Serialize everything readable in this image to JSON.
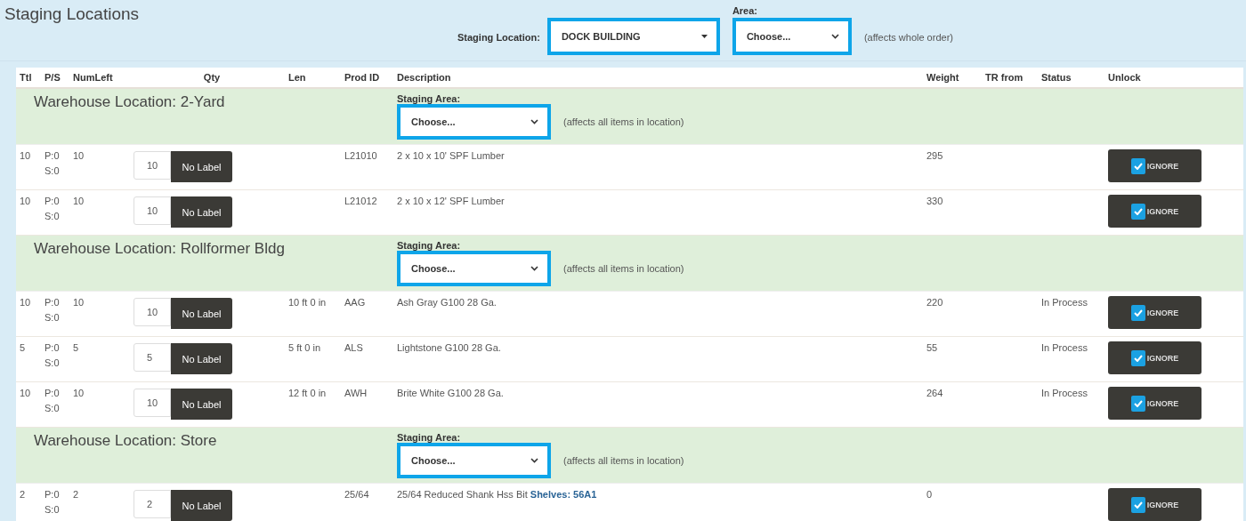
{
  "title": "Staging Locations",
  "order_controls": {
    "staging_location": {
      "label": "Staging Location:",
      "value": "DOCK BUILDING"
    },
    "area": {
      "label": "Area:",
      "value": "Choose...",
      "note": "(affects whole order)"
    }
  },
  "table": {
    "columns": [
      "Ttl",
      "P/S",
      "NumLeft",
      "Qty",
      "Len",
      "Prod ID",
      "Description",
      "Weight",
      "TR from",
      "Status",
      "Unlock"
    ],
    "groups": [
      {
        "title": "Warehouse Location: 2-Yard",
        "area_label": "Staging Area:",
        "area_value": "Choose...",
        "note": "(affects all items in location)",
        "rows": [
          {
            "ttl": "10",
            "p": "P:0",
            "s": "S:0",
            "numleft": "10",
            "qty": "10",
            "label_button": "No Label",
            "prod_id": "L21010",
            "description": "2 x 10 x 10' SPF Lumber",
            "weight": "295",
            "ignore": "IGNORE",
            "checked": true
          },
          {
            "ttl": "10",
            "p": "P:0",
            "s": "S:0",
            "numleft": "10",
            "qty": "10",
            "label_button": "No Label",
            "prod_id": "L21012",
            "description": "2 x 10 x 12' SPF Lumber",
            "weight": "330",
            "ignore": "IGNORE",
            "checked": true
          }
        ]
      },
      {
        "title": "Warehouse Location: Rollformer Bldg",
        "area_label": "Staging Area:",
        "area_value": "Choose...",
        "note": "(affects all items in location)",
        "rows": [
          {
            "ttl": "10",
            "p": "P:0",
            "s": "S:0",
            "numleft": "10",
            "qty": "10",
            "label_button": "No Label",
            "len": "10 ft 0 in",
            "prod_id": "AAG",
            "description": "Ash Gray G100 28 Ga.",
            "weight": "220",
            "status": "In Process",
            "ignore": "IGNORE",
            "checked": true
          },
          {
            "ttl": "5",
            "p": "P:0",
            "s": "S:0",
            "numleft": "5",
            "qty": "5",
            "label_button": "No Label",
            "len": "5 ft 0 in",
            "prod_id": "ALS",
            "description": "Lightstone G100 28 Ga.",
            "weight": "55",
            "status": "In Process",
            "ignore": "IGNORE",
            "checked": true
          },
          {
            "ttl": "10",
            "p": "P:0",
            "s": "S:0",
            "numleft": "10",
            "qty": "10",
            "label_button": "No Label",
            "len": "12 ft 0 in",
            "prod_id": "AWH",
            "description": "Brite White G100 28 Ga.",
            "weight": "264",
            "status": "In Process",
            "ignore": "IGNORE",
            "checked": true
          }
        ]
      },
      {
        "title": "Warehouse Location: Store",
        "area_label": "Staging Area:",
        "area_value": "Choose...",
        "note": "(affects all items in location)",
        "rows": [
          {
            "ttl": "2",
            "p": "P:0",
            "s": "S:0",
            "numleft": "2",
            "qty": "2",
            "label_button": "No Label",
            "prod_id": "25/64",
            "description": "25/64 Reduced Shank Hss Bit **Shelves: 56A1**",
            "weight": "0",
            "ignore": "IGNORE",
            "checked": true
          }
        ]
      }
    ]
  }
}
